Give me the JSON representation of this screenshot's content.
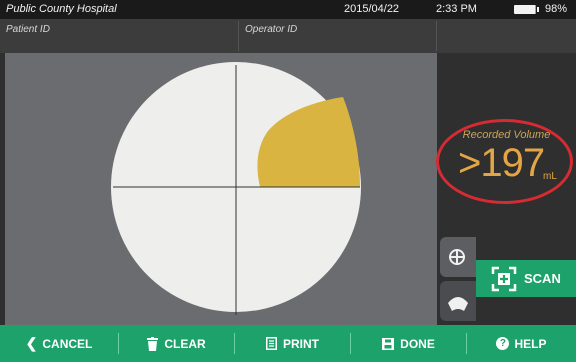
{
  "status": {
    "hospital": "Public County Hospital",
    "date": "2015/04/22",
    "time": "2:33 PM",
    "battery": "98%",
    "battery_level": 0.98
  },
  "ids": {
    "patient_label": "Patient ID",
    "operator_label": "Operator ID"
  },
  "volume": {
    "label": "Recorded Volume",
    "value": ">197",
    "unit": "mL"
  },
  "scan_button": "SCAN",
  "toolbar": {
    "cancel": "CANCEL",
    "clear": "CLEAR",
    "print": "PRINT",
    "done": "DONE",
    "help": "HELP"
  },
  "colors": {
    "accent_green": "#1ca26a",
    "volume_orange": "#e3a545",
    "highlight_red": "#d52b33",
    "bladder_yellow": "#d9b440"
  },
  "icons": [
    "chevron-left-icon",
    "trash-icon",
    "print-icon",
    "save-icon",
    "help-icon",
    "scan-icon",
    "crosshair-icon",
    "ultrasound-cone-icon"
  ]
}
